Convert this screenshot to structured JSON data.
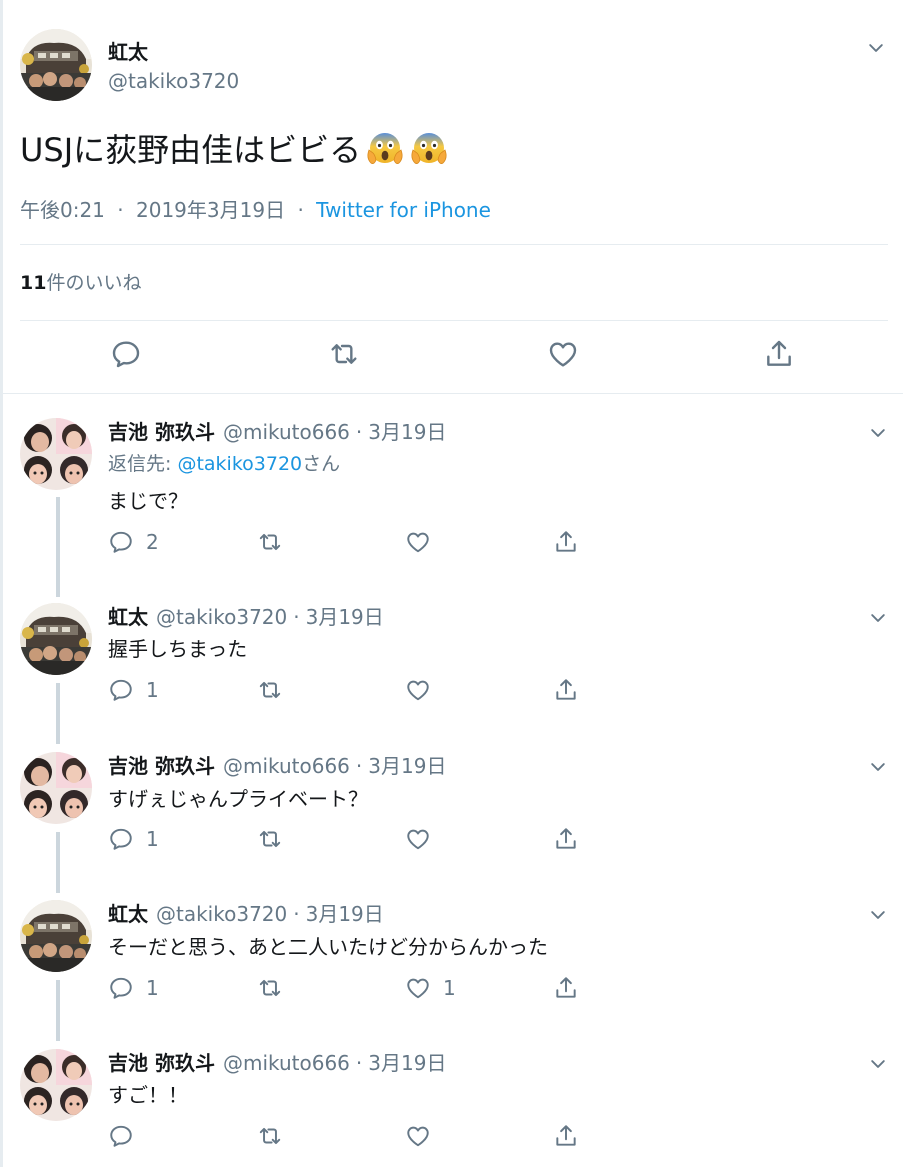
{
  "main_tweet": {
    "name": "虹太",
    "handle": "@takiko3720",
    "text": "USJに荻野由佳はビビる",
    "emojis": [
      "face-screaming-in-fear",
      "face-screaming-in-fear"
    ],
    "time": "午後0:21",
    "separator": "·",
    "date": "2019年3月19日",
    "source": "Twitter for iPhone",
    "likes_count": "11",
    "likes_label": "件のいいね"
  },
  "replies": [
    {
      "name": "吉池 弥玖斗",
      "handle": "@mikuto666",
      "date": "3月19日",
      "reply_to_prefix": "返信先: ",
      "reply_to_handle": "@takiko3720",
      "reply_to_suffix": "さん",
      "text": "まじで？",
      "reply_count": "2",
      "retweet_count": "",
      "like_count": ""
    },
    {
      "name": "虹太",
      "handle": "@takiko3720",
      "date": "3月19日",
      "text": "握手しちまった",
      "reply_count": "1",
      "retweet_count": "",
      "like_count": ""
    },
    {
      "name": "吉池 弥玖斗",
      "handle": "@mikuto666",
      "date": "3月19日",
      "text": "すげぇじゃんプライベート？",
      "reply_count": "1",
      "retweet_count": "",
      "like_count": ""
    },
    {
      "name": "虹太",
      "handle": "@takiko3720",
      "date": "3月19日",
      "text": "そーだと思う、あと二人いたけど分からんかった",
      "reply_count": "1",
      "retweet_count": "",
      "like_count": "1"
    },
    {
      "name": "吉池 弥玖斗",
      "handle": "@mikuto666",
      "date": "3月19日",
      "text": "すご！！",
      "reply_count": "",
      "retweet_count": "",
      "like_count": ""
    }
  ],
  "colors": {
    "text": "#14171a",
    "secondary": "#657786",
    "link": "#1b95e0",
    "border": "#e6ecf0",
    "thread_line": "#ccd6dd"
  },
  "icons": [
    "chevron-down-icon",
    "reply-icon",
    "retweet-icon",
    "like-icon",
    "share-icon"
  ]
}
